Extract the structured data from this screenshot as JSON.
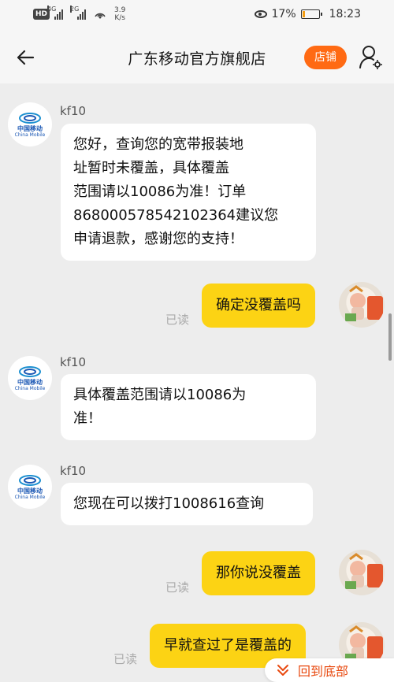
{
  "status_bar": {
    "hd_badge": "HD",
    "net_1": "4G",
    "net_2": "2G",
    "speed_value": "3.9",
    "speed_unit": "K/s",
    "battery": "17%",
    "battery_level": 0.17,
    "time": "18:23"
  },
  "header": {
    "title": "广东移动官方旗舰店",
    "shop_label": "店铺"
  },
  "agent_avatar": {
    "brand_cn": "中国移动",
    "brand_en": "China Mobile"
  },
  "messages": [
    {
      "from": "agent",
      "sender": "kf10",
      "lines": [
        "您好，查询您的宽带报装地",
        "址暂时未覆盖，具体覆盖",
        "范围请以10086为准！订单",
        "868000578542102364建议您",
        "申请退款，感谢您的支持！"
      ]
    },
    {
      "from": "me",
      "text": "确定没覆盖吗",
      "status": "已读"
    },
    {
      "from": "agent",
      "sender": "kf10",
      "lines": [
        "具体覆盖范围请以10086为",
        "准！"
      ]
    },
    {
      "from": "agent",
      "sender": "kf10",
      "lines": [
        "您现在可以拨打1008616查询"
      ]
    },
    {
      "from": "me",
      "text": "那你说没覆盖",
      "status": "已读"
    },
    {
      "from": "me",
      "text": "早就查过了是覆盖的",
      "status": "已读"
    }
  ],
  "scroll_to_bottom_label": "回到底部",
  "colors": {
    "accent": "#ff6a13",
    "outgoing_bubble": "#fcd314",
    "incoming_bubble": "#ffffff",
    "background": "#ededed",
    "brand_blue": "#1a57b4"
  }
}
